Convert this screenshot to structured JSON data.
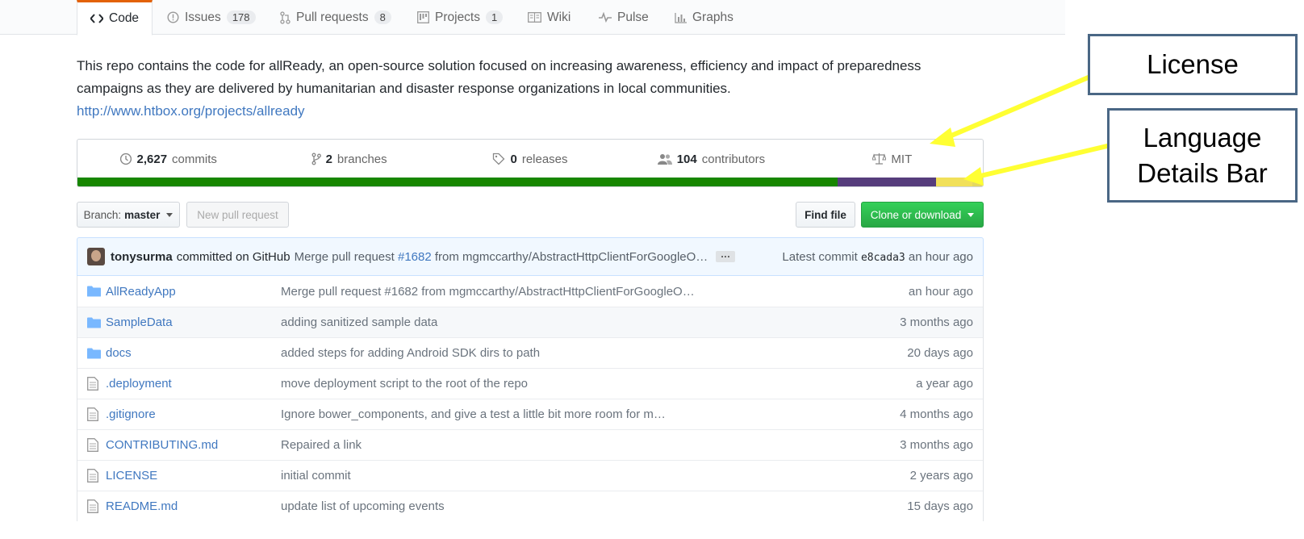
{
  "tabs": [
    {
      "label": "Code",
      "icon": "code-icon",
      "active": true
    },
    {
      "label": "Issues",
      "count": "178",
      "icon": "issue-icon"
    },
    {
      "label": "Pull requests",
      "count": "8",
      "icon": "pull-request-icon"
    },
    {
      "label": "Projects",
      "count": "1",
      "icon": "project-icon"
    },
    {
      "label": "Wiki",
      "icon": "book-icon"
    },
    {
      "label": "Pulse",
      "icon": "pulse-icon"
    },
    {
      "label": "Graphs",
      "icon": "graph-icon"
    }
  ],
  "description": {
    "text": "This repo contains the code for allReady, an open-source solution focused on increasing awareness, efficiency and impact of preparedness campaigns as they are delivered by humanitarian and disaster response organizations in local communities.",
    "url": "http://www.htbox.org/projects/allready"
  },
  "summary": {
    "commits": {
      "count": "2,627",
      "label": "commits"
    },
    "branches": {
      "count": "2",
      "label": "branches"
    },
    "releases": {
      "count": "0",
      "label": "releases"
    },
    "contributors": {
      "count": "104",
      "label": "contributors"
    },
    "license": "MIT"
  },
  "language_bar": [
    {
      "color": "#178600",
      "fraction": 0.84
    },
    {
      "color": "#563d7c",
      "fraction": 0.108
    },
    {
      "color": "#f1e05a",
      "fraction": 0.04
    },
    {
      "color": "#e4d860",
      "fraction": 0.012
    }
  ],
  "toolbar": {
    "branch_label": "Branch:",
    "branch_value": "master",
    "new_pr": "New pull request",
    "find_file": "Find file",
    "clone": "Clone or download"
  },
  "latest_commit": {
    "author": "tonysurma",
    "committed_on": "committed on GitHub",
    "message_prefix": "Merge pull request",
    "pr_number": "#1682",
    "message_suffix": "from mgmccarthy/AbstractHttpClientForGoogleO…",
    "ellipsis": "···",
    "latest_label": "Latest commit",
    "sha": "e8cada3",
    "age": "an hour ago"
  },
  "files": [
    {
      "name": "AllReadyApp",
      "type": "folder",
      "message": "Merge pull request #1682 from mgmccarthy/AbstractHttpClientForGoogleO…",
      "age": "an hour ago"
    },
    {
      "name": "SampleData",
      "type": "folder",
      "message": "adding sanitized sample data",
      "age": "3 months ago"
    },
    {
      "name": "docs",
      "type": "folder",
      "message": "added steps for adding Android SDK dirs to path",
      "age": "20 days ago"
    },
    {
      "name": ".deployment",
      "type": "file",
      "message": "move deployment script to the root of the repo",
      "age": "a year ago"
    },
    {
      "name": ".gitignore",
      "type": "file",
      "message": "Ignore bower_components, and give a test a little bit more room for m…",
      "age": "4 months ago"
    },
    {
      "name": "CONTRIBUTING.md",
      "type": "file",
      "message": "Repaired a link",
      "age": "3 months ago"
    },
    {
      "name": "LICENSE",
      "type": "file",
      "message": "initial commit",
      "age": "2 years ago"
    },
    {
      "name": "README.md",
      "type": "file",
      "message": "update list of upcoming events",
      "age": "15 days ago"
    }
  ],
  "callouts": {
    "license": "License",
    "language_line1": "Language",
    "language_line2": "Details Bar",
    "arrow_color": "#ffff33"
  }
}
